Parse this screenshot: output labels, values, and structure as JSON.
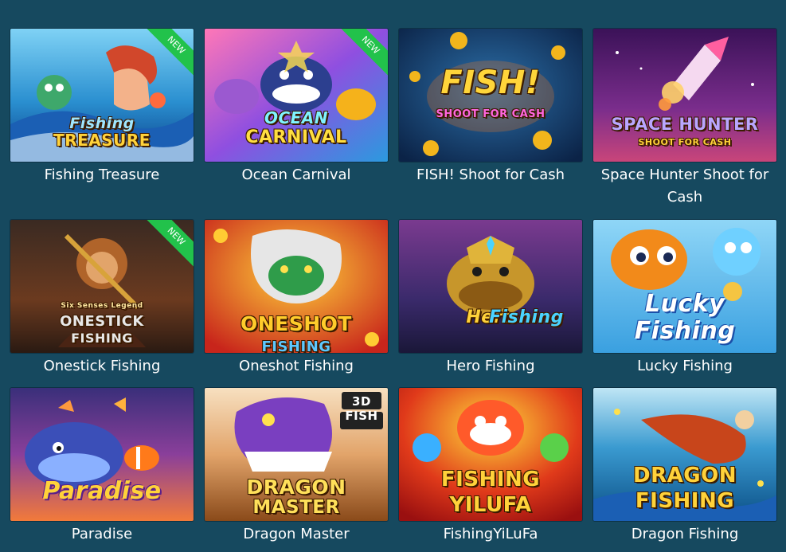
{
  "games": [
    {
      "name": "Fishing Treasure",
      "art_line1": "Fishing",
      "art_line2": "TREASURE",
      "badge": "NEW"
    },
    {
      "name": "Ocean Carnival",
      "art_line1": "OCEAN",
      "art_line2": "CARNIVAL",
      "badge": "NEW"
    },
    {
      "name": "FISH! Shoot for Cash",
      "art_line1": "FISH!",
      "art_line2": "SHOOT FOR CASH",
      "badge": ""
    },
    {
      "name": "Space Hunter Shoot for Cash",
      "art_line1": "SPACE HUNTER",
      "art_line2": "SHOOT FOR CASH",
      "badge": ""
    },
    {
      "name": "Onestick Fishing",
      "art_line0": "Six Senses Legend",
      "art_line1": "ONESTICK",
      "art_line2": "FISHING",
      "badge": "NEW"
    },
    {
      "name": "Oneshot Fishing",
      "art_line1": "ONESHOT",
      "art_line2": "FISHING",
      "badge": ""
    },
    {
      "name": "Hero Fishing",
      "art_line1": "Hero",
      "art_line2": "Fishing",
      "badge": ""
    },
    {
      "name": "Lucky Fishing",
      "art_line1": "Lucky",
      "art_line2": "Fishing",
      "badge": ""
    },
    {
      "name": "Paradise",
      "art_line1": "Paradise",
      "art_line2": "",
      "badge": ""
    },
    {
      "name": "Dragon Master",
      "art_line1": "DRAGON",
      "art_line2": "MASTER",
      "badge": "3D FISH"
    },
    {
      "name": "FishingYiLuFa",
      "art_line1": "FISHING",
      "art_line2": "YILUFA",
      "badge": ""
    },
    {
      "name": "Dragon Fishing",
      "art_line1": "DRAGON",
      "art_line2": "FISHING",
      "badge": ""
    }
  ],
  "colors": {
    "background": "#16495f",
    "new_badge": "#22c24b",
    "caption_text": "#ffffff"
  }
}
